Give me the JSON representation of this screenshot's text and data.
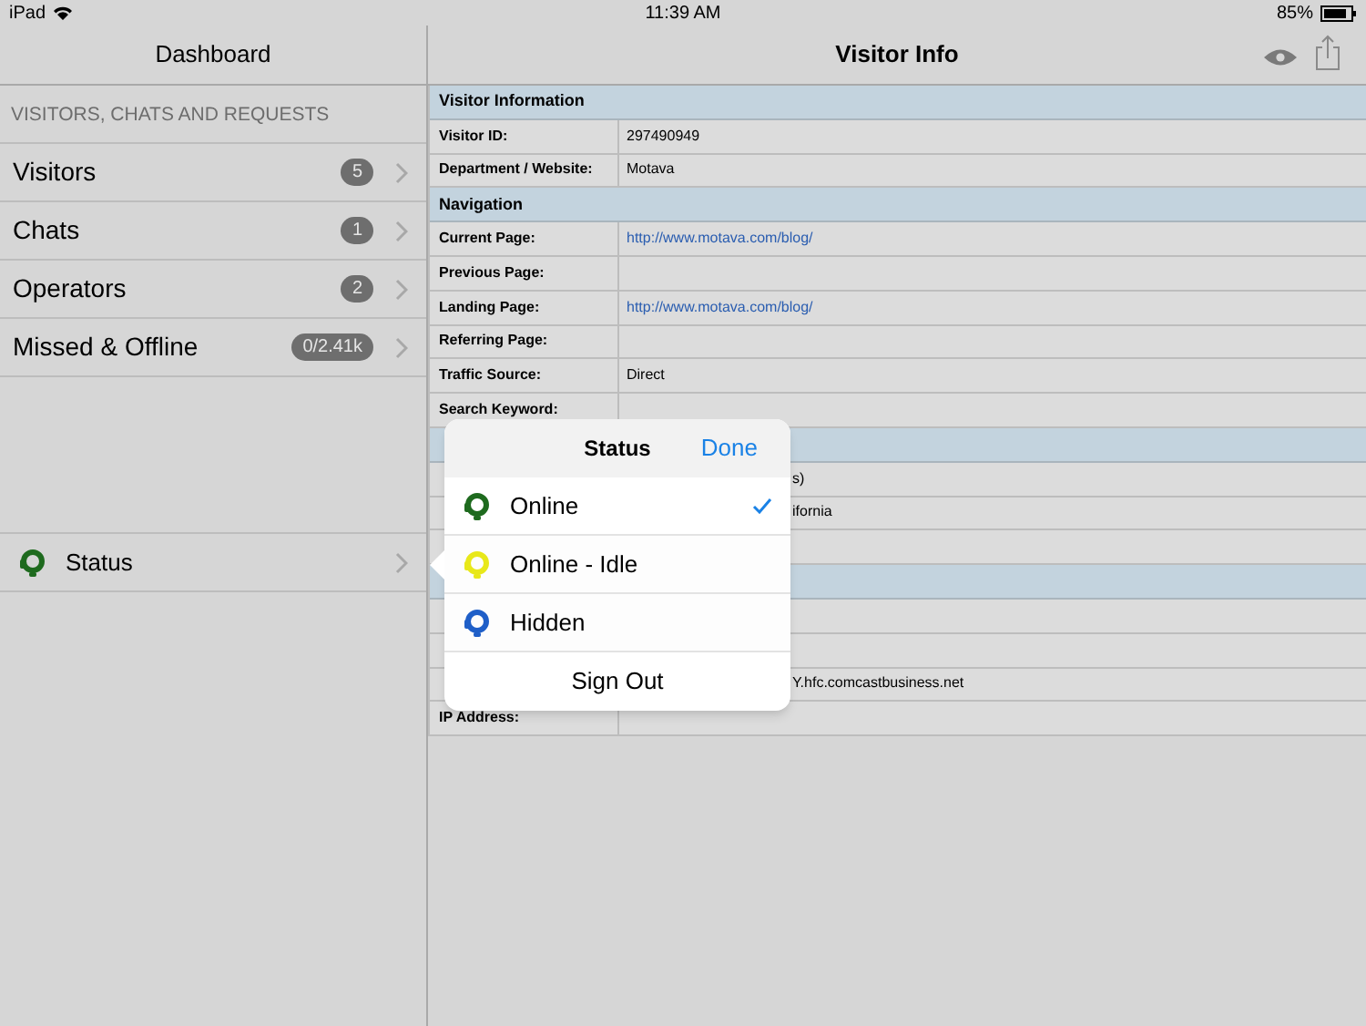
{
  "status_bar": {
    "device": "iPad",
    "time": "11:39 AM",
    "battery": "85%"
  },
  "sidebar": {
    "title": "Dashboard",
    "section": "VISITORS, CHATS AND REQUESTS",
    "items": [
      {
        "label": "Visitors",
        "badge": "5"
      },
      {
        "label": "Chats",
        "badge": "1"
      },
      {
        "label": "Operators",
        "badge": "2"
      },
      {
        "label": "Missed & Offline",
        "badge": "0/2.41k"
      }
    ],
    "status_item": {
      "label": "Status"
    }
  },
  "detail": {
    "title": "Visitor Info",
    "rows": [
      {
        "kind": "section",
        "label": "Visitor Information"
      },
      {
        "kind": "row",
        "label": "Visitor ID:",
        "value": "297490949"
      },
      {
        "kind": "row",
        "label": "Department / Website:",
        "value": "Motava"
      },
      {
        "kind": "section",
        "label": "Navigation"
      },
      {
        "kind": "row",
        "label": "Current Page:",
        "value": "http://www.motava.com/blog/",
        "link": true
      },
      {
        "kind": "row",
        "label": "Previous Page:"
      },
      {
        "kind": "row",
        "label": "Landing Page:",
        "value": "http://www.motava.com/blog/",
        "link": true
      },
      {
        "kind": "row",
        "label": "Referring Page:"
      },
      {
        "kind": "row",
        "label": "Traffic Source:",
        "value": "Direct"
      },
      {
        "kind": "row",
        "label": "Search Keyword:"
      },
      {
        "kind": "covered_section"
      },
      {
        "kind": "covered_row",
        "value": "s)"
      },
      {
        "kind": "covered_row",
        "value": "ifornia"
      },
      {
        "kind": "covered_row"
      },
      {
        "kind": "covered_section"
      },
      {
        "kind": "covered_row"
      },
      {
        "kind": "covered_row"
      },
      {
        "kind": "covered_row",
        "value": "Y.hfc.comcastbusiness.net"
      },
      {
        "kind": "row",
        "label": "IP Address:"
      }
    ]
  },
  "popover": {
    "title": "Status",
    "done": "Done",
    "options": [
      {
        "label": "Online",
        "color": "#1e6a1e",
        "selected": true
      },
      {
        "label": "Online - Idle",
        "color": "#e8e81a",
        "selected": false
      },
      {
        "label": "Hidden",
        "color": "#1f5fc8",
        "selected": false
      }
    ],
    "sign_out": "Sign Out"
  }
}
